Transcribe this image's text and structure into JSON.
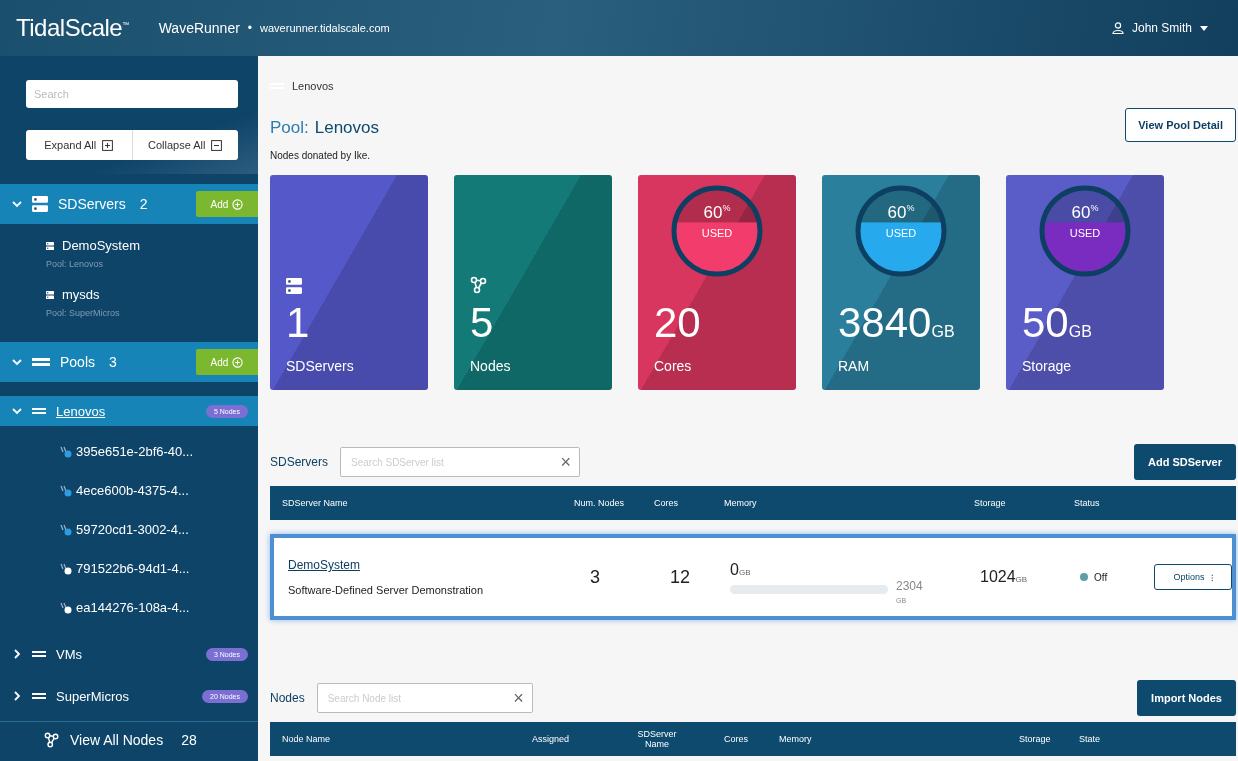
{
  "header": {
    "logo": "TidalScale$^{™}$",
    "app_name": "WaveRunner",
    "separator": "•",
    "host": "waverunner.tidalscale.com",
    "user": "John Smith"
  },
  "sidebar": {
    "search": {
      "placeholder": "Search"
    },
    "expand_all": "Expand All",
    "collapse_all": "Collapse All",
    "groups": [
      {
        "kind": "servers",
        "label": "SDServers",
        "count": "2",
        "expanded": true,
        "add": "Add",
        "children": [
          {
            "name": "DemoSystem",
            "sub": "Pool: Lenovos"
          },
          {
            "name": "mysds",
            "sub": "Pool: SuperMicros"
          }
        ]
      },
      {
        "kind": "pools",
        "label": "Pools",
        "count": "3",
        "expanded": true,
        "add": "Add",
        "children": [
          {
            "name": "Lenovos",
            "badge": "5 Nodes",
            "expanded": true,
            "selected": true,
            "children": [
              {
                "name": "395e651e-2bf6-40...",
                "color": "#2f9be0"
              },
              {
                "name": "4ece600b-4375-4...",
                "color": "#2f9be0"
              },
              {
                "name": "59720cd1-3002-4...",
                "color": "#2f9be0"
              },
              {
                "name": "791522b6-94d1-4...",
                "color": "#ffffff"
              },
              {
                "name": "ea144276-108a-4...",
                "color": "#ffffff"
              }
            ]
          },
          {
            "name": "VMs",
            "badge": "3 Nodes",
            "expanded": false,
            "selected": false
          },
          {
            "name": "SuperMicros",
            "badge": "20 Nodes",
            "expanded": false,
            "selected": false
          }
        ]
      }
    ],
    "view_all": {
      "label": "View All Nodes",
      "count": "28"
    }
  },
  "main": {
    "breadcrumb": "Lenovos",
    "title_prefix": "Pool:",
    "title": "Lenovos",
    "subtitle": "Nodes donated by Ike.",
    "view_detail": "View Pool Detail",
    "cards": [
      {
        "kind": "servers",
        "value": "1",
        "label": "SDServers",
        "color": "#5558c9"
      },
      {
        "kind": "nodes",
        "value": "5",
        "label": "Nodes",
        "color": "#137a78"
      },
      {
        "kind": "gauge",
        "value": "20",
        "label": "Cores",
        "color": "#d8365f",
        "percent": "60",
        "percent_sign": "%",
        "used": "USED"
      },
      {
        "kind": "gauge",
        "value": "3840",
        "unit": "GB",
        "label": "RAM",
        "color": "#2a7f9c",
        "percent": "60",
        "percent_sign": "%",
        "used": "USED"
      },
      {
        "kind": "gauge",
        "value": "50",
        "unit": "GB",
        "label": "Storage",
        "color": "#5a5cc8",
        "percent": "60",
        "percent_sign": "%",
        "used": "USED"
      }
    ],
    "sdservers": {
      "title": "SDServers",
      "search_placeholder": "Search SDServer list",
      "clear": "×",
      "action": "Add SDServer",
      "columns": [
        "SDServer Name",
        "Num. Nodes",
        "Cores",
        "Memory",
        "Storage",
        "Status"
      ],
      "rows": [
        {
          "name": "DemoSystem",
          "description": "Software-Defined Server Demonstration",
          "nodes": "3",
          "cores": "12",
          "memory": "0",
          "memory_unit": "GB",
          "memory_total": "2304",
          "memory_total_unit": "GB",
          "storage": "1024",
          "storage_unit": "GB",
          "status": "Off",
          "options": "Options",
          "options_icon": "⁝",
          "selected": true
        }
      ]
    },
    "nodes": {
      "title": "Nodes",
      "search_placeholder": "Search Node list",
      "clear": "×",
      "action": "Import Nodes",
      "columns": [
        "Node Name",
        "Assigned",
        "SDServer Name",
        "Cores",
        "Memory",
        "Storage",
        "State"
      ]
    }
  }
}
